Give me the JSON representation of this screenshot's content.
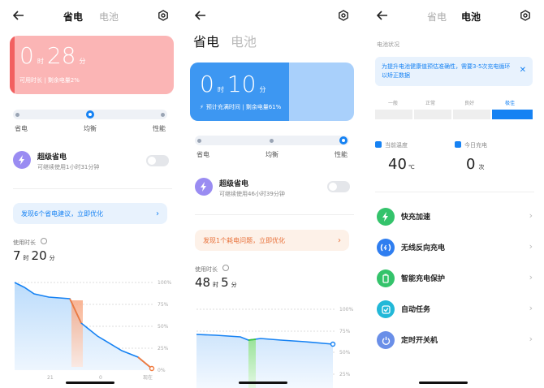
{
  "icons": {
    "back": "back-arrow-icon",
    "settings": "gear-icon",
    "lightning": "lightning-icon",
    "info": "info-icon",
    "close": "close-icon",
    "chevron": "chevron-right-icon",
    "thermometer": "thermometer-icon",
    "battery": "battery-icon",
    "wireless": "wireless-charging-icon",
    "protect": "battery-protect-icon",
    "task": "auto-task-icon",
    "power": "power-icon"
  },
  "colors": {
    "accent": "#1682f3",
    "saver_card": "#fbb5b5",
    "battery_card": "#3d97f2",
    "suggest_bg": "#e8f2fd",
    "issue_bg": "#fdf1e8"
  },
  "tabs": {
    "save": "省电",
    "battery": "电池"
  },
  "panel1": {
    "remain": {
      "h": "0",
      "h_unit": "时",
      "m": "28",
      "m_unit": "分",
      "caption": "可用时长 | 剩余电量2%"
    },
    "modes": {
      "save": "省电",
      "balance": "均衡",
      "perf": "性能"
    },
    "super": {
      "title": "超级省电",
      "sub": "可继续使用1小时31分钟"
    },
    "suggest": "发现6个省电建议，立即优化",
    "usage": {
      "label": "使用时长",
      "h": "7",
      "h_unit": "时",
      "m": "20",
      "m_unit": "分"
    },
    "yticks": [
      "100%",
      "75%",
      "50%",
      "25%",
      "0%"
    ],
    "xticks": [
      "21",
      "0",
      "现在"
    ]
  },
  "panel2": {
    "charge": {
      "h": "0",
      "h_unit": "时",
      "m": "10",
      "m_unit": "分",
      "caption": "预计充满时间 | 剩余电量61%"
    },
    "modes": {
      "save": "省电",
      "balance": "均衡",
      "perf": "性能"
    },
    "super": {
      "title": "超级省电",
      "sub": "可继续使用46小时39分钟"
    },
    "issue": "发现1个耗电问题，立即优化",
    "usage": {
      "label": "使用时长",
      "h": "48",
      "h_unit": "时",
      "m": "5",
      "m_unit": "分"
    },
    "yticks": [
      "100%",
      "75%",
      "50%",
      "25%"
    ]
  },
  "panel3": {
    "section": "电池状况",
    "notice": "为提升电池健康值预估准确性，需要3-5次充电循环以矫正数据",
    "health": [
      "一般",
      "正常",
      "良好",
      "极佳"
    ],
    "temp": {
      "label": "当前温度",
      "value": "40",
      "unit": "℃"
    },
    "today": {
      "label": "今日充电",
      "value": "0",
      "unit": "次"
    },
    "rows": [
      {
        "label": "快充加速"
      },
      {
        "label": "无线反向充电"
      },
      {
        "label": "智能充电保护"
      },
      {
        "label": "自动任务"
      },
      {
        "label": "定时开关机"
      }
    ]
  }
}
